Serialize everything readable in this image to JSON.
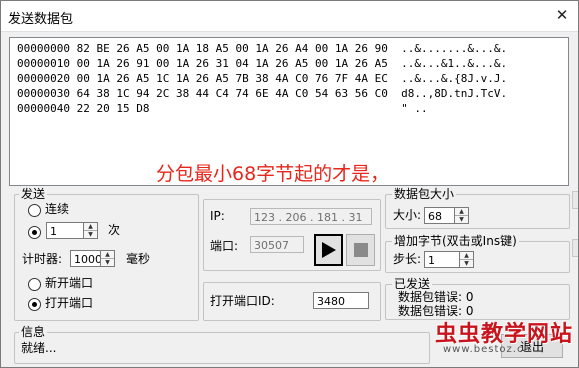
{
  "window": {
    "title": "发送数据包"
  },
  "hex": {
    "lines": [
      "00000000 82 BE 26 A5 00 1A 18 A5 00 1A 26 A4 00 1A 26 90  ..&.......&...&.",
      "00000010 00 1A 26 91 00 1A 26 31 04 1A 26 A5 00 1A 26 A5  ..&...&1..&...&.",
      "00000020 00 1A 26 A5 1C 1A 26 A5 7B 38 4A C0 76 7F 4A EC  ..&...&.{8J.v.J.",
      "00000030 64 38 1C 94 2C 38 44 C4 74 6E 4A C0 54 63 56 C0  d8..,8D.tnJ.TcV.",
      "00000040 22 20 15 D8                                      \" .."
    ]
  },
  "annotation": "分包最小68字节起的才是，",
  "send": {
    "group_label": "发送",
    "continuous_label": "连续",
    "count_value": "1",
    "count_unit": "次",
    "timer_label": "计时器:",
    "timer_value": "1000",
    "timer_unit": "毫秒",
    "new_port_label": "新开端口",
    "open_port_label": "打开端口"
  },
  "conn": {
    "ip_label": "IP:",
    "ip_value": "123 . 206 . 181 . 31",
    "port_label": "端口:",
    "port_value": "30507",
    "open_port_id_label": "打开端口ID:",
    "open_port_id_value": "3480"
  },
  "packet_size": {
    "group_label": "数据包大小",
    "size_label": "大小:",
    "size_value": "68"
  },
  "add_bytes": {
    "group_label": "增加字节(双击或Ins键)",
    "step_label": "步长:",
    "step_value": "1"
  },
  "sent": {
    "group_label": "已发送",
    "error_line_1": "数据包错误: 0",
    "error_line_2": "数据包错误: 0"
  },
  "info": {
    "group_label": "信息",
    "status": "就绪..."
  },
  "exit_button": "退出",
  "watermark": {
    "main": "虫虫教学网站",
    "url": "www.bestoz.cn"
  }
}
